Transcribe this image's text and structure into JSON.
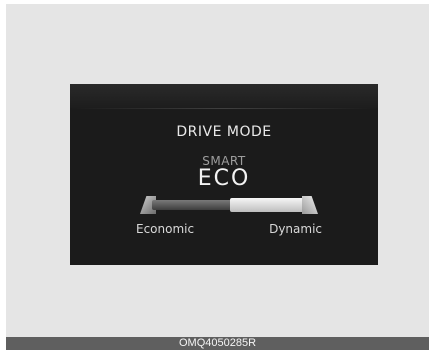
{
  "screen": {
    "title": "DRIVE MODE",
    "submode": "SMART",
    "mode": "ECO",
    "left_label": "Economic",
    "right_label": "Dynamic"
  },
  "caption": "OMQ4050285R",
  "colors": {
    "frame_bg": "#e5e5e5",
    "screen_bg": "#1b1b1b",
    "caption_bg": "#5f5f5f"
  }
}
